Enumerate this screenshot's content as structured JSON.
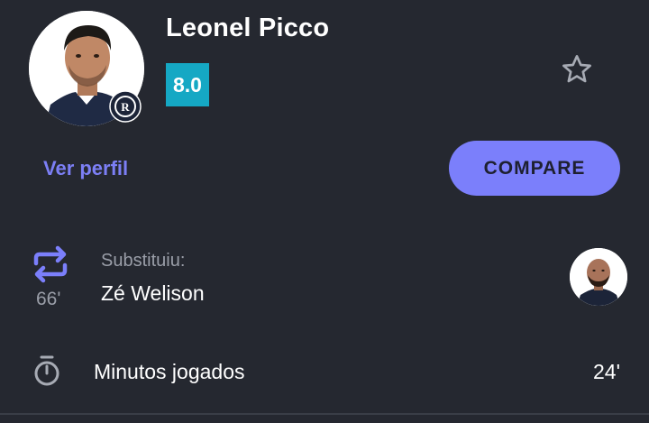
{
  "player": {
    "name": "Leonel Picco",
    "rating": "8.0",
    "photo_icon": "player-photo",
    "club_badge_icon": "remo-club-crest"
  },
  "actions": {
    "view_profile_label": "Ver perfil",
    "compare_label": "COMPARE",
    "favorite_icon": "star-outline-icon"
  },
  "substitution": {
    "icon": "swap-arrows-icon",
    "minute": "66'",
    "label": "Substituiu:",
    "player_name": "Zé Welison"
  },
  "minutes_played": {
    "icon": "stopwatch-icon",
    "label": "Minutos jogados",
    "value": "24'"
  },
  "colors": {
    "background": "#252830",
    "accent": "#7b7ffb",
    "rating_badge": "#15a8c4",
    "muted_text": "#9a9ea8"
  }
}
